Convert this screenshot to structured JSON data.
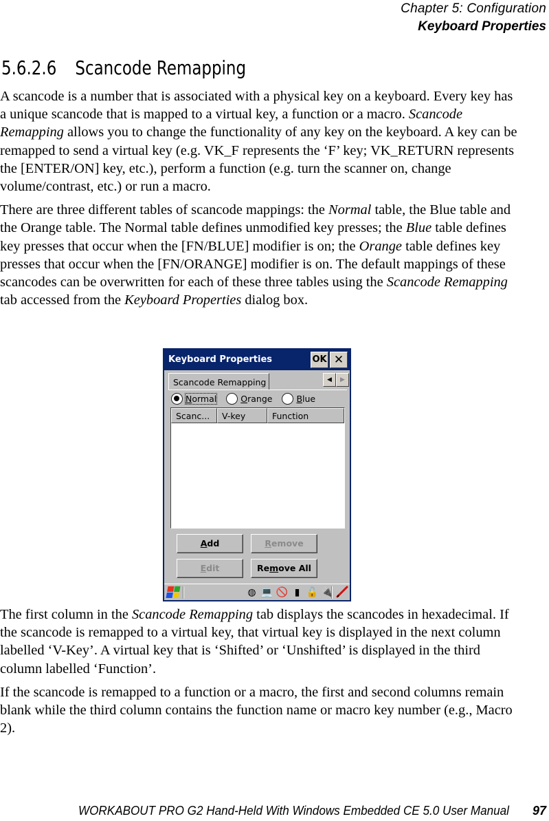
{
  "running_head": {
    "chapter": "Chapter  5:  Configuration",
    "section": "Keyboard Properties"
  },
  "heading": {
    "number": "5.6.2.6",
    "title": "Scancode  Remapping"
  },
  "paragraphs_top": [
    [
      {
        "t": "A scancode is a number that is associated with a physical key on a keyboard. Every key has a unique scancode that is mapped to a virtual key, a function or a macro. "
      },
      {
        "t": "Scancode Remapping",
        "i": true
      },
      {
        "t": " allows you to change the functionality of any key on the keyboard. A key can be remapped to send a virtual key (e.g. VK_F represents the ‘F’ key; VK_RETURN represents the [ENTER/ON] key, etc.), perform a function (e.g. turn the scanner on, change volume/contrast, etc.) or run a macro."
      }
    ],
    [
      {
        "t": "There are three different tables of scancode mappings: the "
      },
      {
        "t": "Normal",
        "i": true
      },
      {
        "t": " table, the Blue table and the Orange table. The Normal table defines unmodified key presses; the "
      },
      {
        "t": "Blue",
        "i": true
      },
      {
        "t": " table defines key presses that occur when the [FN/BLUE] modifier is on; the "
      },
      {
        "t": "Orange",
        "i": true
      },
      {
        "t": " table defines key presses that occur when the [FN/ORANGE] modifier is on. The default mappings of these scancodes can be overwritten for each of these three tables using the "
      },
      {
        "t": "Scancode Remapping",
        "i": true
      },
      {
        "t": " tab accessed from the "
      },
      {
        "t": "Keyboard Properties",
        "i": true
      },
      {
        "t": " dialog box."
      }
    ]
  ],
  "paragraphs_bottom": [
    [
      {
        "t": "The first column in the "
      },
      {
        "t": "Scancode Remapping",
        "i": true
      },
      {
        "t": " tab displays the scancodes in hexadecimal. If the scancode is remapped to a virtual key, that virtual key is displayed in the next column labelled ‘V-Key’. A virtual key that is ‘Shifted’ or ‘Unshifted’ is displayed in the third column labelled ‘Function’."
      }
    ],
    [
      {
        "t": "If the scancode is remapped to a function or a macro, the first and second columns remain blank while the third column contains the function name or macro key number (e.g., Macro 2)."
      }
    ]
  ],
  "dialog": {
    "title": "Keyboard Properties",
    "ok_label": "OK",
    "close_label": "✕",
    "tab_label": "Scancode Remapping",
    "scroll_left": "◀",
    "scroll_right": "▶",
    "radios": [
      {
        "label": "Normal",
        "accel": "N",
        "checked": true
      },
      {
        "label": "Orange",
        "accel": "O",
        "checked": false
      },
      {
        "label": "Blue",
        "accel": "B",
        "checked": false
      }
    ],
    "columns": [
      "Scanc...",
      "V-key",
      "Function"
    ],
    "rows": [],
    "buttons": {
      "add": {
        "pre": "",
        "accel": "A",
        "post": "dd",
        "enabled": true
      },
      "remove": {
        "pre": "",
        "accel": "R",
        "post": "emove",
        "enabled": false
      },
      "edit": {
        "pre": "",
        "accel": "E",
        "post": "dit",
        "enabled": false
      },
      "remove_all": {
        "pre": "Re",
        "accel": "m",
        "post": "ove All",
        "enabled": true
      }
    },
    "taskbar": {
      "tray_icons": [
        "network-icon",
        "connection-icon",
        "no-signal-icon",
        "battery-icon",
        "lock-icon",
        "power-plug-icon"
      ],
      "tray_glyphs": [
        "◍",
        "💻",
        "🚫",
        "▮",
        "🔓",
        "🔌"
      ]
    }
  },
  "footer": {
    "manual": "WORKABOUT PRO G2 Hand-Held With Windows Embedded CE 5.0 User Manual",
    "page": "97"
  }
}
